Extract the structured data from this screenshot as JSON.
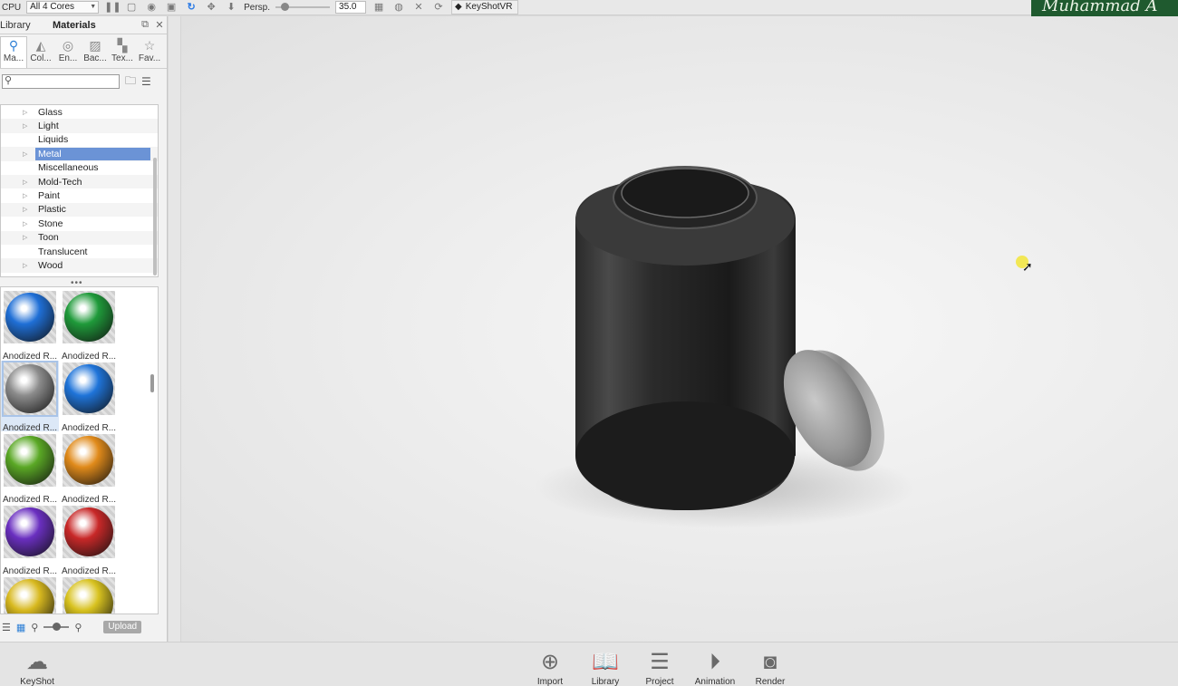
{
  "toolbar": {
    "cpu_label": "CPU",
    "cores_value": "All 4 Cores",
    "persp_label": "Persp.",
    "fov_value": "35.0",
    "vr_label": "KeyShotVR"
  },
  "banner": {
    "text": "Muhammad A"
  },
  "panel": {
    "library_label": "Library",
    "title": "Materials",
    "tabs": [
      {
        "label": "Ma...",
        "icon": "materials-icon"
      },
      {
        "label": "Col...",
        "icon": "colors-icon"
      },
      {
        "label": "En...",
        "icon": "environments-icon"
      },
      {
        "label": "Bac...",
        "icon": "backplates-icon"
      },
      {
        "label": "Tex...",
        "icon": "textures-icon"
      },
      {
        "label": "Fav...",
        "icon": "favorites-icon"
      }
    ],
    "search_placeholder": "",
    "tree": [
      {
        "name": "Glass",
        "expandable": true
      },
      {
        "name": "Light",
        "expandable": true
      },
      {
        "name": "Liquids",
        "expandable": false
      },
      {
        "name": "Metal",
        "expandable": true,
        "selected": true
      },
      {
        "name": "Miscellaneous",
        "expandable": false
      },
      {
        "name": "Mold-Tech",
        "expandable": true
      },
      {
        "name": "Paint",
        "expandable": true
      },
      {
        "name": "Plastic",
        "expandable": true
      },
      {
        "name": "Stone",
        "expandable": true
      },
      {
        "name": "Toon",
        "expandable": true
      },
      {
        "name": "Translucent",
        "expandable": false
      },
      {
        "name": "Wood",
        "expandable": true
      }
    ],
    "materials": [
      {
        "caption": "Anodized R...",
        "color": "#1f6fd6"
      },
      {
        "caption": "Anodized R...",
        "color": "#1f9a3a"
      },
      {
        "caption": "Anodized R...",
        "color": "#8c8c8c",
        "selected": true
      },
      {
        "caption": "Anodized R...",
        "color": "#1f74d9"
      },
      {
        "caption": "Anodized R...",
        "color": "#5aa825"
      },
      {
        "caption": "Anodized R...",
        "color": "#e08a1a"
      },
      {
        "caption": "Anodized R...",
        "color": "#6a2fc0"
      },
      {
        "caption": "Anodized R...",
        "color": "#c82828"
      },
      {
        "caption": "",
        "color": "#d8b91f"
      },
      {
        "caption": "",
        "color": "#d8c21f"
      }
    ],
    "upload_label": "Upload"
  },
  "bottom": {
    "cloud_label": "KeyShot Cloud",
    "items": [
      {
        "label": "Import",
        "icon": "import-icon"
      },
      {
        "label": "Library",
        "icon": "library-icon",
        "active": true
      },
      {
        "label": "Project",
        "icon": "project-icon"
      },
      {
        "label": "Animation",
        "icon": "animation-icon"
      },
      {
        "label": "Render",
        "icon": "render-icon"
      }
    ]
  },
  "colors": {
    "accent": "#2f80d6",
    "selection": "#6b93d6",
    "banner": "#1f5a2f"
  }
}
